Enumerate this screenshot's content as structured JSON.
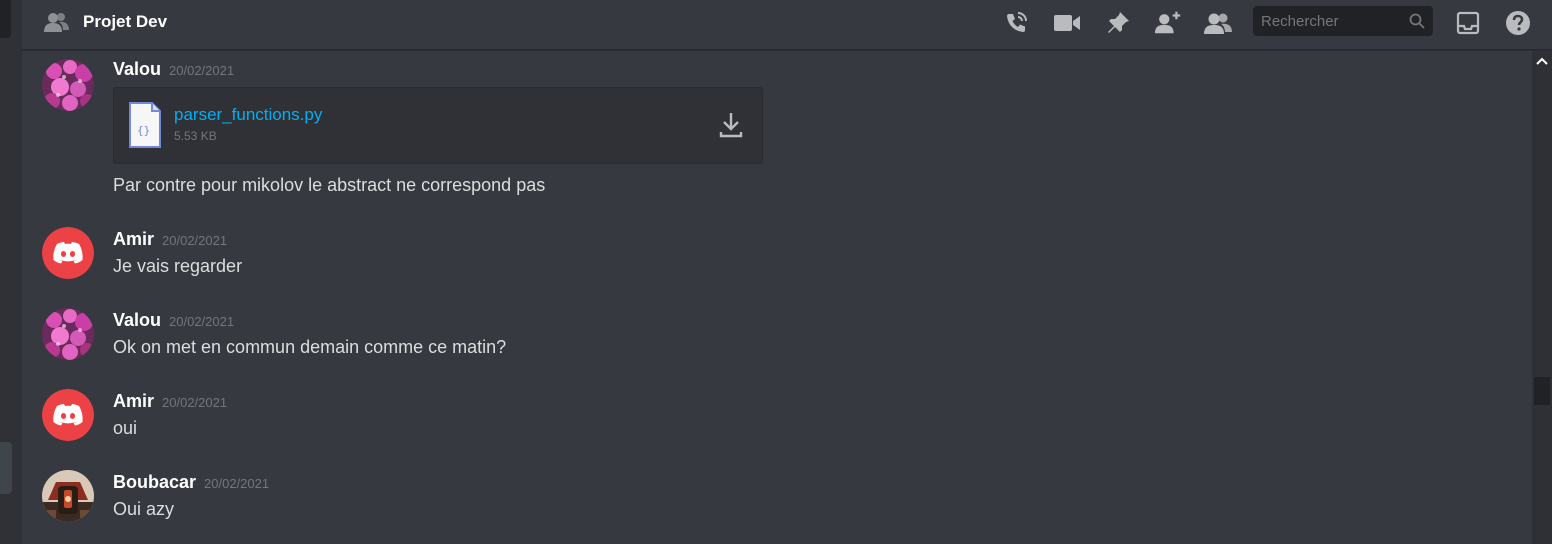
{
  "header": {
    "title": "Projet Dev",
    "search_placeholder": "Rechercher",
    "icons": [
      "group-dm-icon",
      "voice-call-icon",
      "video-call-icon",
      "pin-icon",
      "add-friend-icon",
      "members-icon",
      "search-icon",
      "inbox-icon",
      "help-icon"
    ]
  },
  "messages": [
    {
      "author": "Valou",
      "timestamp": "20/02/2021",
      "avatar": "flowers-avatar",
      "attachment": {
        "name": "parser_functions.py",
        "size": "5.53 KB"
      },
      "text": "Par contre pour mikolov le abstract ne correspond pas"
    },
    {
      "author": "Amir",
      "timestamp": "20/02/2021",
      "avatar": "discord-logo-avatar",
      "text": "Je vais regarder"
    },
    {
      "author": "Valou",
      "timestamp": "20/02/2021",
      "avatar": "flowers-avatar",
      "text": "Ok on met en commun demain comme ce matin?"
    },
    {
      "author": "Amir",
      "timestamp": "20/02/2021",
      "avatar": "discord-logo-avatar",
      "text": "oui"
    },
    {
      "author": "Boubacar",
      "timestamp": "20/02/2021",
      "avatar": "photo-avatar",
      "text": "Oui azy"
    }
  ],
  "colors": {
    "background": "#36393f",
    "link": "#00b0f4",
    "discord_red": "#ed4245",
    "timestamp": "#72767d"
  }
}
